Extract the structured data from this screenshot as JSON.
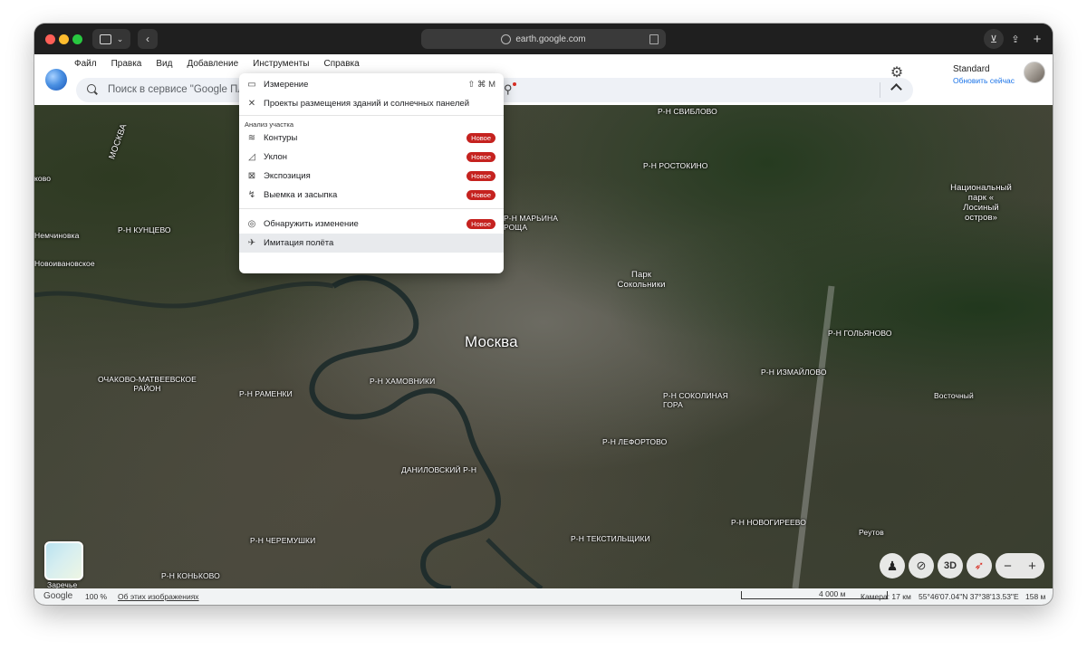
{
  "browser": {
    "url": "earth.google.com"
  },
  "menubar": {
    "items": [
      "Файл",
      "Правка",
      "Вид",
      "Добавление",
      "Инструменты",
      "Справка"
    ]
  },
  "search": {
    "placeholder": "Поиск в сервисе \"Google Пла"
  },
  "account": {
    "plan": "Standard",
    "upgrade": "Обновить сейчас"
  },
  "tools_menu": {
    "items": [
      {
        "icon": "ruler-icon",
        "label": "Измерение",
        "shortcut": "⇧ ⌘ M"
      },
      {
        "icon": "building-icon",
        "label": "Проекты размещения зданий и солнечных панелей"
      }
    ],
    "section_title": "Анализ участка",
    "section_items": [
      {
        "icon": "contours-icon",
        "label": "Контуры",
        "badge": "Новое"
      },
      {
        "icon": "slope-icon",
        "label": "Уклон",
        "badge": "Новое"
      },
      {
        "icon": "exposure-icon",
        "label": "Экспозиция",
        "badge": "Новое"
      },
      {
        "icon": "cut-fill-icon",
        "label": "Выемка и засыпка",
        "badge": "Новое"
      }
    ],
    "bottom_items": [
      {
        "icon": "change-detect-icon",
        "label": "Обнаружить изменение",
        "badge": "Новое"
      },
      {
        "icon": "plane-icon",
        "label": "Имитация полёта"
      }
    ]
  },
  "map_labels": {
    "city": "Москва",
    "moskva_river": "МОСКВА",
    "sviblovo": "Р-Н СВИБЛОВО",
    "rostokino": "Р-Н РОСТОКИНО",
    "maryina_roshcha": "Р-Н МАРЬИНА\nРОЩА",
    "kuntsevo": "Р-Н КУНЦЕВО",
    "nemchinovka": "Немчиновка",
    "novoivanovskoe": "Новоивановское",
    "bovo": "ково",
    "ochakovo": "ОЧАКОВО-МАТВЕЕВСКОЕ\nРАЙОН",
    "ramenki": "Р-Н РАМЕНКИ",
    "khamovniki": "Р-Н ХАМОВНИКИ",
    "sokolniki_park": "Парк\nСокольники",
    "losiny_park": "Национальный\nпарк «\nЛосиный\nостров»",
    "golyanovo": "Р-Н ГОЛЬЯНОВО",
    "izmaylovo": "Р-Н ИЗМАЙЛОВО",
    "sokolinaya": "Р-Н СОКОЛИНАЯ\nГОРА",
    "vostochny": "Восточный",
    "lefortovo": "Р-Н ЛЕФОРТОВО",
    "danilovsky": "ДАНИЛОВСКИЙ Р-Н",
    "novogireevo": "Р-Н НОВОГИРЕЕВО",
    "reutov": "Реутов",
    "cheremushki": "Р-Н ЧЕРЕМУШКИ",
    "tekstilshchiki": "Р-Н ТЕКСТИЛЬЩИКИ",
    "konkovo": "Р-Н КОНЬКОВО",
    "zarechye": "Заречье"
  },
  "controls": {
    "three_d": "3D",
    "zoom_out": "−",
    "zoom_in": "+"
  },
  "status": {
    "brand": "Google",
    "zoom": "100 %",
    "about_imagery": "Об этих изображениях",
    "scale": "4 000 м",
    "camera": "Камера: 17 км",
    "coords": "55°46'07.04\"N 37°38'13.53\"E",
    "elevation": "158 м"
  }
}
